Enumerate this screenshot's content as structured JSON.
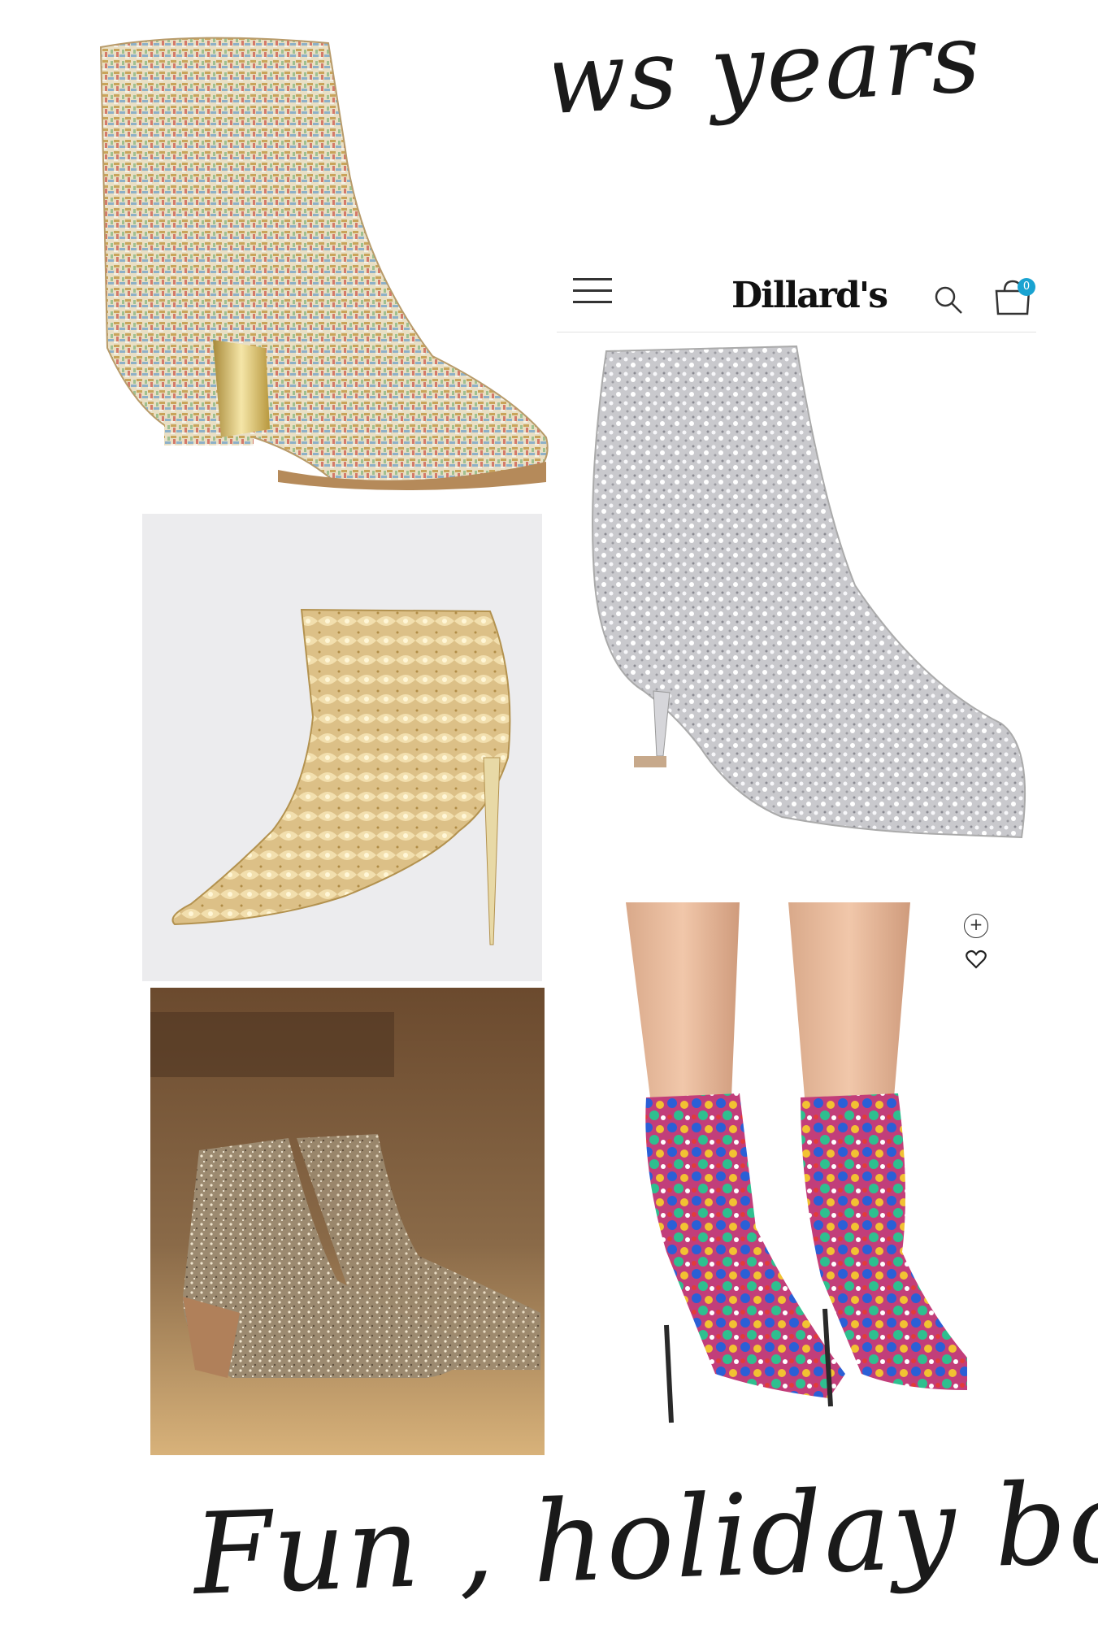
{
  "collage": {
    "title_top": "News years",
    "title_bottom": "Fun , holiday boots"
  },
  "dillards": {
    "brand": "Dillard's",
    "cart_count": "0"
  },
  "icons": [
    "menu-icon",
    "search-icon",
    "cart-icon",
    "plus-icon",
    "heart-icon"
  ],
  "colors": {
    "text": "#1a1a1a",
    "cart_badge": "#1aa3d1",
    "gold": "#d8b878",
    "silver": "#c8c8cc"
  }
}
